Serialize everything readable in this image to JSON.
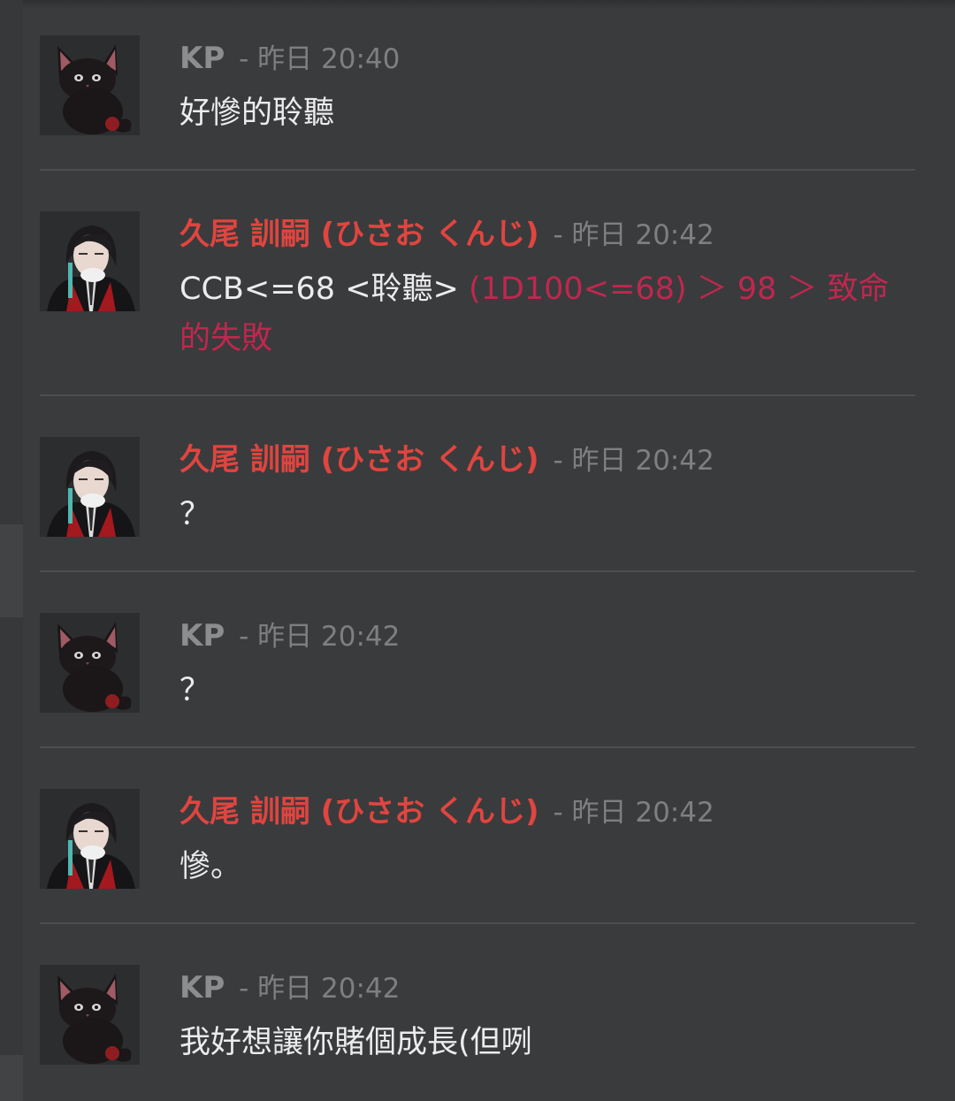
{
  "messages": [
    {
      "author": "KP",
      "separator": " - ",
      "date": "昨日",
      "time": "20:40",
      "text": "好慘的聆聽"
    },
    {
      "author": "久尾 訓嗣 (ひさお くんじ)",
      "separator": " - ",
      "date": "昨日",
      "time": "20:42",
      "command": "CCB<=68 <聆聽> ",
      "result": "(1D100<=68) ＞ 98 ＞ 致命的失敗"
    },
    {
      "author": "久尾 訓嗣 (ひさお くんじ)",
      "separator": " - ",
      "date": "昨日",
      "time": "20:42",
      "text": "？"
    },
    {
      "author": "KP",
      "separator": " - ",
      "date": "昨日",
      "time": "20:42",
      "text": "？"
    },
    {
      "author": "久尾 訓嗣 (ひさお くんじ)",
      "separator": " - ",
      "date": "昨日",
      "time": "20:42",
      "text": "慘。"
    },
    {
      "author": "KP",
      "separator": " - ",
      "date": "昨日",
      "time": "20:42",
      "text": "我好想讓你賭個成長(但咧"
    }
  ],
  "colors": {
    "background": "#3a3b3d",
    "kp_name": "#8c8d8f",
    "character_name": "#e0453f",
    "timestamp": "#7e7f81",
    "message_text": "#ececec",
    "dice_result": "#c0274f",
    "divider": "#4d4e50"
  },
  "icons": {
    "kp_avatar": "black-cat-avatar-icon",
    "character_avatar": "dark-haired-man-avatar-icon"
  }
}
